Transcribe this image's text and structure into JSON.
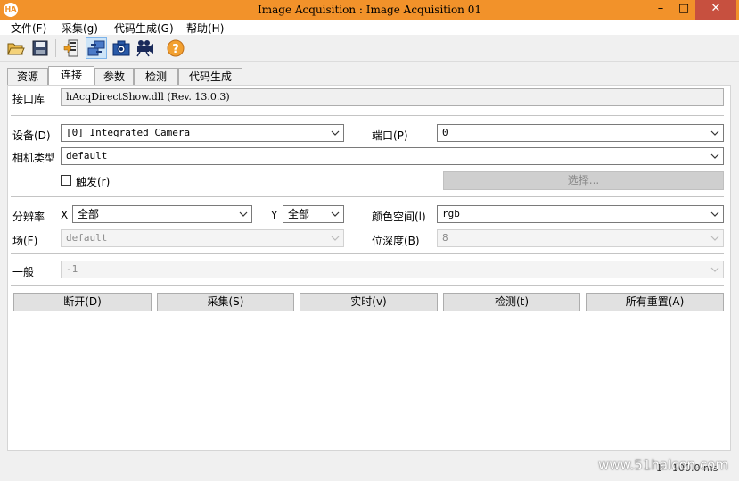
{
  "window": {
    "title": "Image Acquisition : Image Acquisition 01",
    "app_icon": "HA"
  },
  "menu": [
    "文件(F)",
    "采集(g)",
    "代码生成(G)",
    "帮助(H)"
  ],
  "tabs": [
    "资源",
    "连接",
    "参数",
    "检测",
    "代码生成"
  ],
  "connection": {
    "interface_label": "接口库",
    "interface_value": "hAcqDirectShow.dll (Rev. 13.0.3)",
    "device_label": "设备(D)",
    "device_value": "[0] Integrated Camera",
    "port_label": "端口(P)",
    "port_value": "0",
    "camera_type_label": "相机类型",
    "camera_type_value": "default",
    "trigger_label": "触发(r)",
    "select_label": "选择...",
    "resolution_label": "分辨率",
    "x_label": "X",
    "x_value": "全部",
    "y_label": "Y",
    "y_value": "全部",
    "color_space_label": "颜色空间(l)",
    "color_space_value": "rgb",
    "field_label": "场(F)",
    "field_value": "default",
    "bit_depth_label": "位深度(B)",
    "bit_depth_value": "8",
    "general_label": "一般",
    "general_value": "-1"
  },
  "actions": [
    "断开(D)",
    "采集(S)",
    "实时(v)",
    "检测(t)",
    "所有重置(A)"
  ],
  "status": {
    "count": "1",
    "time": "100.0 ms"
  },
  "watermark": "www.51halcon.com"
}
